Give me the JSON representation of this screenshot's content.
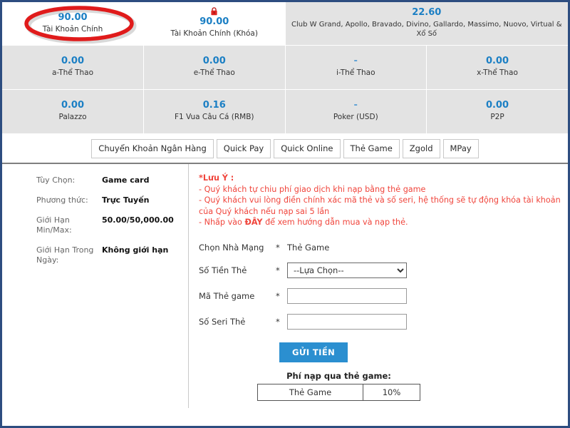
{
  "balances": {
    "row_top": [
      {
        "amount": "90.00",
        "label": "Tài Khoản Chính",
        "icon": "",
        "shaded": false,
        "highlighted": true
      },
      {
        "amount": "90.00",
        "label": "Tài Khoản Chính (Khóa)",
        "icon": "lock-icon",
        "shaded": false,
        "highlighted": false
      },
      {
        "amount": "22.60",
        "label": "Club W Grand, Apollo, Bravado, Divino, Gallardo, Massimo, Nuovo, Virtual & Xổ Số",
        "icon": "",
        "shaded": true,
        "highlighted": false
      }
    ],
    "row_mid": [
      {
        "amount": "0.00",
        "label": "a-Thể Thao"
      },
      {
        "amount": "0.00",
        "label": "e-Thể Thao"
      },
      {
        "amount": "-",
        "label": "i-Thể Thao"
      },
      {
        "amount": "0.00",
        "label": "x-Thể Thao"
      }
    ],
    "row_bottom": [
      {
        "amount": "0.00",
        "label": "Palazzo"
      },
      {
        "amount": "0.16",
        "label": "F1 Vua Câu Cá (RMB)"
      },
      {
        "amount": "-",
        "label": "Poker (USD)"
      },
      {
        "amount": "0.00",
        "label": "P2P"
      }
    ]
  },
  "tabs": [
    {
      "label": "Chuyển Khoản Ngân Hàng",
      "active": false
    },
    {
      "label": "Quick Pay",
      "active": false
    },
    {
      "label": "Quick Online",
      "active": false
    },
    {
      "label": "Thẻ Game",
      "active": true
    },
    {
      "label": "Zgold",
      "active": false
    },
    {
      "label": "MPay",
      "active": false
    }
  ],
  "info": {
    "option_label": "Tùy Chọn:",
    "option_value": "Game card",
    "method_label": "Phương thức:",
    "method_value": "Trực Tuyến",
    "limit_label": "Giới Hạn Min/Max:",
    "limit_value": "50.00/50,000.00",
    "daily_label": "Giới Hạn Trong Ngày:",
    "daily_value": "Không giới hạn"
  },
  "note": {
    "title": "*Lưu Ý :",
    "line1": "- Quý khách tự chiu phí giao dịch khi nạp bằng thẻ game",
    "line2a": "- Quý khách vui lòng điền chính xác mã thẻ và số seri, hệ thống sẽ tự động khóa tài khoản",
    "line2b": "của Quý khách nếu nạp sai 5 lần",
    "line3_pre": "- Nhấp vào ",
    "line3_link": "ĐÂY",
    "line3_post": " để xem hướng dẫn mua và nạp thẻ."
  },
  "form": {
    "provider_label": "Chọn Nhà Mạng",
    "provider_value": "Thẻ Game",
    "amount_label": "Số Tiền Thẻ",
    "amount_selected": "--Lựa Chọn--",
    "code_label": "Mã Thẻ game",
    "code_value": "",
    "serial_label": "Số Seri Thẻ",
    "serial_value": "",
    "required_mark": "*",
    "submit_label": "GỬI TIỀN"
  },
  "fee": {
    "title": "Phí nạp qua thẻ game:",
    "rows": [
      {
        "name": "Thẻ Game",
        "value": "10%"
      }
    ]
  },
  "colors": {
    "frame_blue": "#2d4d80",
    "amount_blue": "#1b7fc4",
    "note_red": "#f0453c",
    "button_blue": "#2b8fd0",
    "cell_gray": "#e3e3e3",
    "annotation_red": "#e01b1b"
  }
}
